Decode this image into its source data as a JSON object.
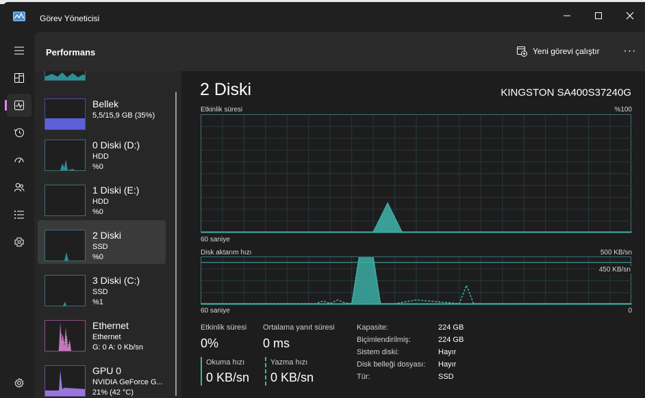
{
  "window": {
    "title": "Görev Yöneticisi"
  },
  "header": {
    "title": "Performans",
    "run_task_label": "Yeni görevi çalıştır",
    "more_label": "···"
  },
  "nav": {
    "items": [
      "menu-icon",
      "processes-icon",
      "performance-icon",
      "app-history-icon",
      "startup-icon",
      "users-icon",
      "details-icon",
      "services-icon",
      "settings-icon"
    ]
  },
  "devices": [
    {
      "name": "Bellek",
      "sub1": "5,5/15,9 GB (35%)",
      "sub2": "",
      "sub3": ""
    },
    {
      "name": "0 Diski (D:)",
      "sub1": "HDD",
      "sub2": "%0",
      "sub3": ""
    },
    {
      "name": "1 Diski (E:)",
      "sub1": "HDD",
      "sub2": "%0",
      "sub3": ""
    },
    {
      "name": "2 Diski",
      "sub1": "SSD",
      "sub2": "%0",
      "sub3": ""
    },
    {
      "name": "3 Diski (C:)",
      "sub1": "SSD",
      "sub2": "%1",
      "sub3": ""
    },
    {
      "name": "Ethernet",
      "sub1": "Ethernet",
      "sub2": "G: 0 A: 0 Kb/sn",
      "sub3": ""
    },
    {
      "name": "GPU 0",
      "sub1": "NVIDIA GeForce G...",
      "sub2": "21% (42 °C)",
      "sub3": ""
    }
  ],
  "detail": {
    "title": "2 Diski",
    "model": "KINGSTON SA400S37240G",
    "activity_label": "Etkinlik süresi",
    "activity_max": "%100",
    "activity_time": "60 saniye",
    "activity_min": "",
    "transfer_label": "Disk aktarım hızı",
    "transfer_max": "500 KB/sn",
    "transfer_mark": "450 KB/sn",
    "transfer_time": "60 saniye",
    "transfer_min": "0",
    "stats": {
      "active_label": "Etkinlik süresi",
      "active_value": "0%",
      "resp_label": "Ortalama yanıt süresi",
      "resp_value": "0 ms",
      "read_label": "Okuma hızı",
      "read_value": "0 KB/sn",
      "write_label": "Yazma hızı",
      "write_value": "0 KB/sn"
    },
    "info": [
      {
        "key": "Kapasite:",
        "value": "224 GB"
      },
      {
        "key": "Biçimlendirilmiş:",
        "value": "224 GB"
      },
      {
        "key": "Sistem diski:",
        "value": "Hayır"
      },
      {
        "key": "Disk belleği dosyası:",
        "value": "Hayır"
      },
      {
        "key": "Tür:",
        "value": "SSD"
      }
    ]
  },
  "colors": {
    "disk_accent": "#3fb5ad",
    "memory_accent": "#5b5fd8",
    "ethernet_accent": "#e08ad6",
    "gpu_accent": "#a57ff0",
    "nav_active": "#e387ee"
  },
  "chart_data": [
    {
      "type": "area",
      "title": "Etkinlik süresi",
      "xlabel": "60 saniye",
      "ylabel": "",
      "ylim": [
        0,
        100
      ],
      "x": [
        60,
        38,
        36,
        34,
        32,
        0
      ],
      "series": [
        {
          "values": [
            0,
            0,
            0,
            25,
            0,
            0
          ]
        }
      ]
    },
    {
      "type": "line",
      "title": "Disk aktarım hızı",
      "xlabel": "60 saniye",
      "ylabel": "",
      "ylim": [
        0,
        500
      ],
      "x": [
        60,
        44,
        43,
        42,
        41,
        40,
        39,
        38,
        36,
        35,
        33,
        30,
        24,
        23,
        22,
        21,
        0
      ],
      "series": [
        {
          "values": [
            0,
            0,
            30,
            0,
            40,
            10,
            0,
            500,
            500,
            0,
            0,
            40,
            0,
            200,
            0,
            0,
            0
          ]
        },
        {
          "values": [
            0,
            0,
            0,
            0,
            0,
            0,
            0,
            500,
            500,
            0,
            0,
            0,
            0,
            0,
            0,
            0,
            0
          ]
        }
      ]
    }
  ]
}
